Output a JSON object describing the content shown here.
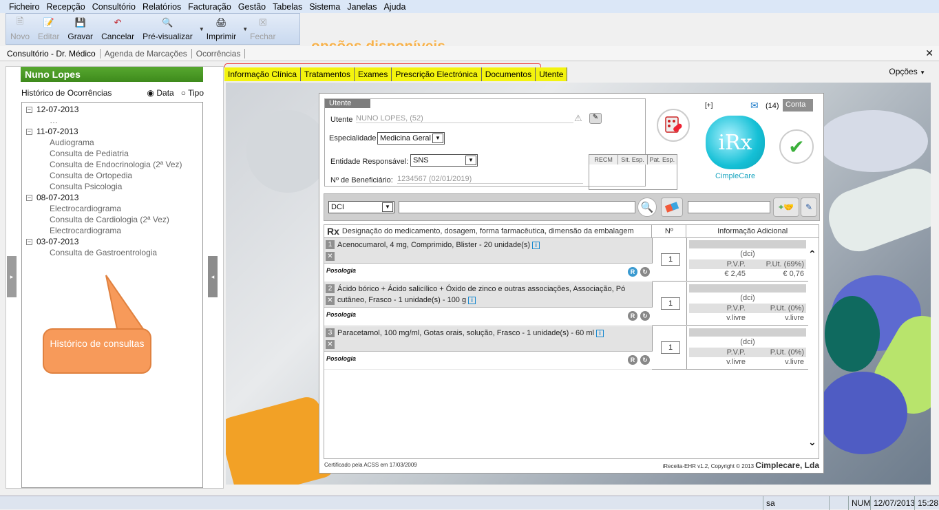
{
  "menu": [
    "Ficheiro",
    "Recepção",
    "Consultório",
    "Relatórios",
    "Facturação",
    "Gestão",
    "Tabelas",
    "Sistema",
    "Janelas",
    "Ajuda"
  ],
  "toolbar": {
    "novo": "Novo",
    "editar": "Editar",
    "gravar": "Gravar",
    "cancelar": "Cancelar",
    "previsualizar": "Pré-visualizar",
    "imprimir": "Imprimir",
    "fechar": "Fechar"
  },
  "tabs": [
    "Consultório - Dr. Médico",
    "Agenda de Marcações",
    "Ocorrências"
  ],
  "annotation_top": "opções disponíveis",
  "annotation_left": "Histórico de consultas",
  "patient_name": "Nuno Lopes",
  "history": {
    "label": "Histórico de Ocorrências",
    "opt_data": "Data",
    "opt_tipo": "Tipo",
    "groups": [
      {
        "date": "12-07-2013",
        "items": [
          ""
        ]
      },
      {
        "date": "11-07-2013",
        "items": [
          "Audiograma",
          "Consulta de Pediatria",
          "Consulta de Endocrinologia (2ª Vez)",
          "Consulta de Ortopedia",
          "Consulta Psicologia"
        ]
      },
      {
        "date": "08-07-2013",
        "items": [
          "Electrocardiograma",
          "Consulta de Cardiologia (2ª Vez)",
          "Electrocardiograma"
        ]
      },
      {
        "date": "03-07-2013",
        "items": [
          "Consulta de Gastroentrologia"
        ]
      }
    ]
  },
  "opcoes": "Opções",
  "subtabs": [
    "Informação Clínica",
    "Tratamentos",
    "Exames",
    "Prescrição Electrónica",
    "Documentos",
    "Utente"
  ],
  "utente": {
    "box_label": "Utente",
    "utente_label": "Utente",
    "utente_value": "NUNO LOPES, (52)",
    "esp_label": "Especialidade",
    "esp_value": "Medicina Geral",
    "ent_label": "Entidade Responsável:",
    "ent_value": "SNS",
    "benef_label": "Nº de Beneficiário:",
    "benef_value": "1234567  (02/01/2019)",
    "recm": [
      "RECM",
      "Sit. Esp.",
      "Pat. Esp."
    ]
  },
  "top_right": {
    "plus": "[+]",
    "count": "(14)",
    "conta": "Conta",
    "logo_text": "iRx",
    "brand": "CimpleCare"
  },
  "search": {
    "type": "DCI"
  },
  "list_header": {
    "rx": "Rx",
    "desc": "Designação do medicamento, dosagem, forma farmacêutica, dimensão da embalagem",
    "num": "Nº",
    "info": "Informação Adicional"
  },
  "meds": [
    {
      "n": "1",
      "text": "Acenocumarol, 4 mg, Comprimido, Blister - 20 unidade(s)",
      "qty": "1",
      "dci": "(dci)",
      "pvp_label": "P.V.P.",
      "put_label": "P.Ut. (69%)",
      "pvp": "€ 2,45",
      "put": "€ 0,76",
      "posologia": "Posologia"
    },
    {
      "n": "2",
      "text": "Ácido bórico + Ácido salicílico + Óxido de zinco e outras associações, Associação, Pó cutâneo, Frasco - 1 unidade(s) - 100 g",
      "qty": "1",
      "dci": "(dci)",
      "pvp_label": "P.V.P.",
      "put_label": "P.Ut. (0%)",
      "pvp": "v.livre",
      "put": "v.livre",
      "posologia": "Posologia"
    },
    {
      "n": "3",
      "text": "Paracetamol, 100 mg/ml, Gotas orais, solução, Frasco - 1 unidade(s) - 60 ml",
      "qty": "1",
      "dci": "(dci)",
      "pvp_label": "P.V.P.",
      "put_label": "P.Ut. (0%)",
      "pvp": "v.livre",
      "put": "v.livre",
      "posologia": "Posologia"
    }
  ],
  "footer": {
    "left": "Certificado pela ACSS em 17/03/2009",
    "right": "iReceita-EHR v1.2, Copyright © 2013 ",
    "brand": "Cimplecare, Lda"
  },
  "status": {
    "user": "sa",
    "num": "NUM",
    "date": "12/07/2013",
    "time": "15:28"
  }
}
